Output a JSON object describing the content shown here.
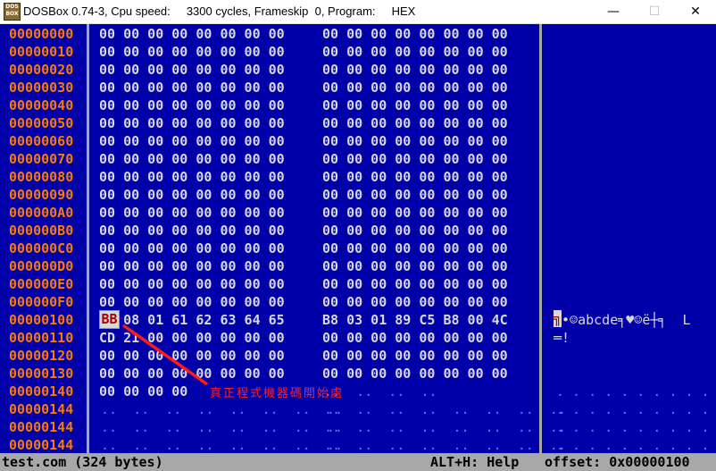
{
  "window": {
    "title": "DOSBox 0.74-3, Cpu speed:     3300 cycles, Frameskip  0, Program:     HEX",
    "icon_text": "DOS BOX",
    "min_glyph": "—",
    "max_glyph": "☐",
    "close_glyph": "✕"
  },
  "rows": [
    {
      "addr": "00000000",
      "b1": "00 00 00 00 00 00 00 00",
      "b2": "00 00 00 00 00 00 00 00",
      "ascii": ""
    },
    {
      "addr": "00000010",
      "b1": "00 00 00 00 00 00 00 00",
      "b2": "00 00 00 00 00 00 00 00",
      "ascii": ""
    },
    {
      "addr": "00000020",
      "b1": "00 00 00 00 00 00 00 00",
      "b2": "00 00 00 00 00 00 00 00",
      "ascii": ""
    },
    {
      "addr": "00000030",
      "b1": "00 00 00 00 00 00 00 00",
      "b2": "00 00 00 00 00 00 00 00",
      "ascii": ""
    },
    {
      "addr": "00000040",
      "b1": "00 00 00 00 00 00 00 00",
      "b2": "00 00 00 00 00 00 00 00",
      "ascii": ""
    },
    {
      "addr": "00000050",
      "b1": "00 00 00 00 00 00 00 00",
      "b2": "00 00 00 00 00 00 00 00",
      "ascii": ""
    },
    {
      "addr": "00000060",
      "b1": "00 00 00 00 00 00 00 00",
      "b2": "00 00 00 00 00 00 00 00",
      "ascii": ""
    },
    {
      "addr": "00000070",
      "b1": "00 00 00 00 00 00 00 00",
      "b2": "00 00 00 00 00 00 00 00",
      "ascii": ""
    },
    {
      "addr": "00000080",
      "b1": "00 00 00 00 00 00 00 00",
      "b2": "00 00 00 00 00 00 00 00",
      "ascii": ""
    },
    {
      "addr": "00000090",
      "b1": "00 00 00 00 00 00 00 00",
      "b2": "00 00 00 00 00 00 00 00",
      "ascii": ""
    },
    {
      "addr": "000000A0",
      "b1": "00 00 00 00 00 00 00 00",
      "b2": "00 00 00 00 00 00 00 00",
      "ascii": ""
    },
    {
      "addr": "000000B0",
      "b1": "00 00 00 00 00 00 00 00",
      "b2": "00 00 00 00 00 00 00 00",
      "ascii": ""
    },
    {
      "addr": "000000C0",
      "b1": "00 00 00 00 00 00 00 00",
      "b2": "00 00 00 00 00 00 00 00",
      "ascii": ""
    },
    {
      "addr": "000000D0",
      "b1": "00 00 00 00 00 00 00 00",
      "b2": "00 00 00 00 00 00 00 00",
      "ascii": ""
    },
    {
      "addr": "000000E0",
      "b1": "00 00 00 00 00 00 00 00",
      "b2": "00 00 00 00 00 00 00 00",
      "ascii": ""
    },
    {
      "addr": "000000F0",
      "b1": "00 00 00 00 00 00 00 00",
      "b2": "00 00 00 00 00 00 00 00",
      "ascii": ""
    },
    {
      "addr": "00000100",
      "b1": "   08 01 61 62 63 64 65",
      "b2": "B8 03 01 89 C5 B8 00 4C",
      "ascii": " •☺abcde╕♥☺ë┼╕  L"
    },
    {
      "addr": "00000110",
      "b1": "CD 21 00 00 00 00 00 00",
      "b2": "00 00 00 00 00 00 00 00",
      "ascii": "═!"
    },
    {
      "addr": "00000120",
      "b1": "00 00 00 00 00 00 00 00",
      "b2": "00 00 00 00 00 00 00 00",
      "ascii": ""
    },
    {
      "addr": "00000130",
      "b1": "00 00 00 00 00 00 00 00",
      "b2": "00 00 00 00 00 00 00 00",
      "ascii": ""
    },
    {
      "addr": "00000140",
      "b1": "00 00 00 00",
      "b2": "",
      "ascii": ""
    },
    {
      "addr": "00000144",
      "b1": "..  ..  ..  ..  ..  ..  ..  ..",
      "b2": "..  ..  ..  ..  ..  ..  ..  ..",
      "ascii": ". . . . . . . . . . ."
    },
    {
      "addr": "00000144",
      "b1": "..  ..  ..  ..  ..  ..  ..  ..",
      "b2": "..  ..  ..  ..  ..  ..  ..  ..",
      "ascii": ". . . . . . . . . . ."
    },
    {
      "addr": "00000144",
      "b1": "..  ..  ..  ..  ..  ..  ..  ..",
      "b2": "..  ..  ..  ..  ..  ..  ..  ..",
      "ascii": ". . . . . . . . . . ."
    }
  ],
  "cursor_byte": "BB",
  "ascii_cursor": "╗",
  "row140_dots": "..  ..  ..  ..",
  "row140_ascii": ". . . . . . . . . . .",
  "annotation": "真正程式機器碼開始處",
  "status": {
    "file": "test.com (324 bytes)",
    "help": "ALT+H: Help",
    "offset": "offset: 0x00000100"
  },
  "colors": {
    "background": "#0000a8",
    "address": "#fc7a00",
    "hex": "#d8d8d8",
    "annotation": "#ff2020",
    "status_bar": "#a8a8a8"
  }
}
